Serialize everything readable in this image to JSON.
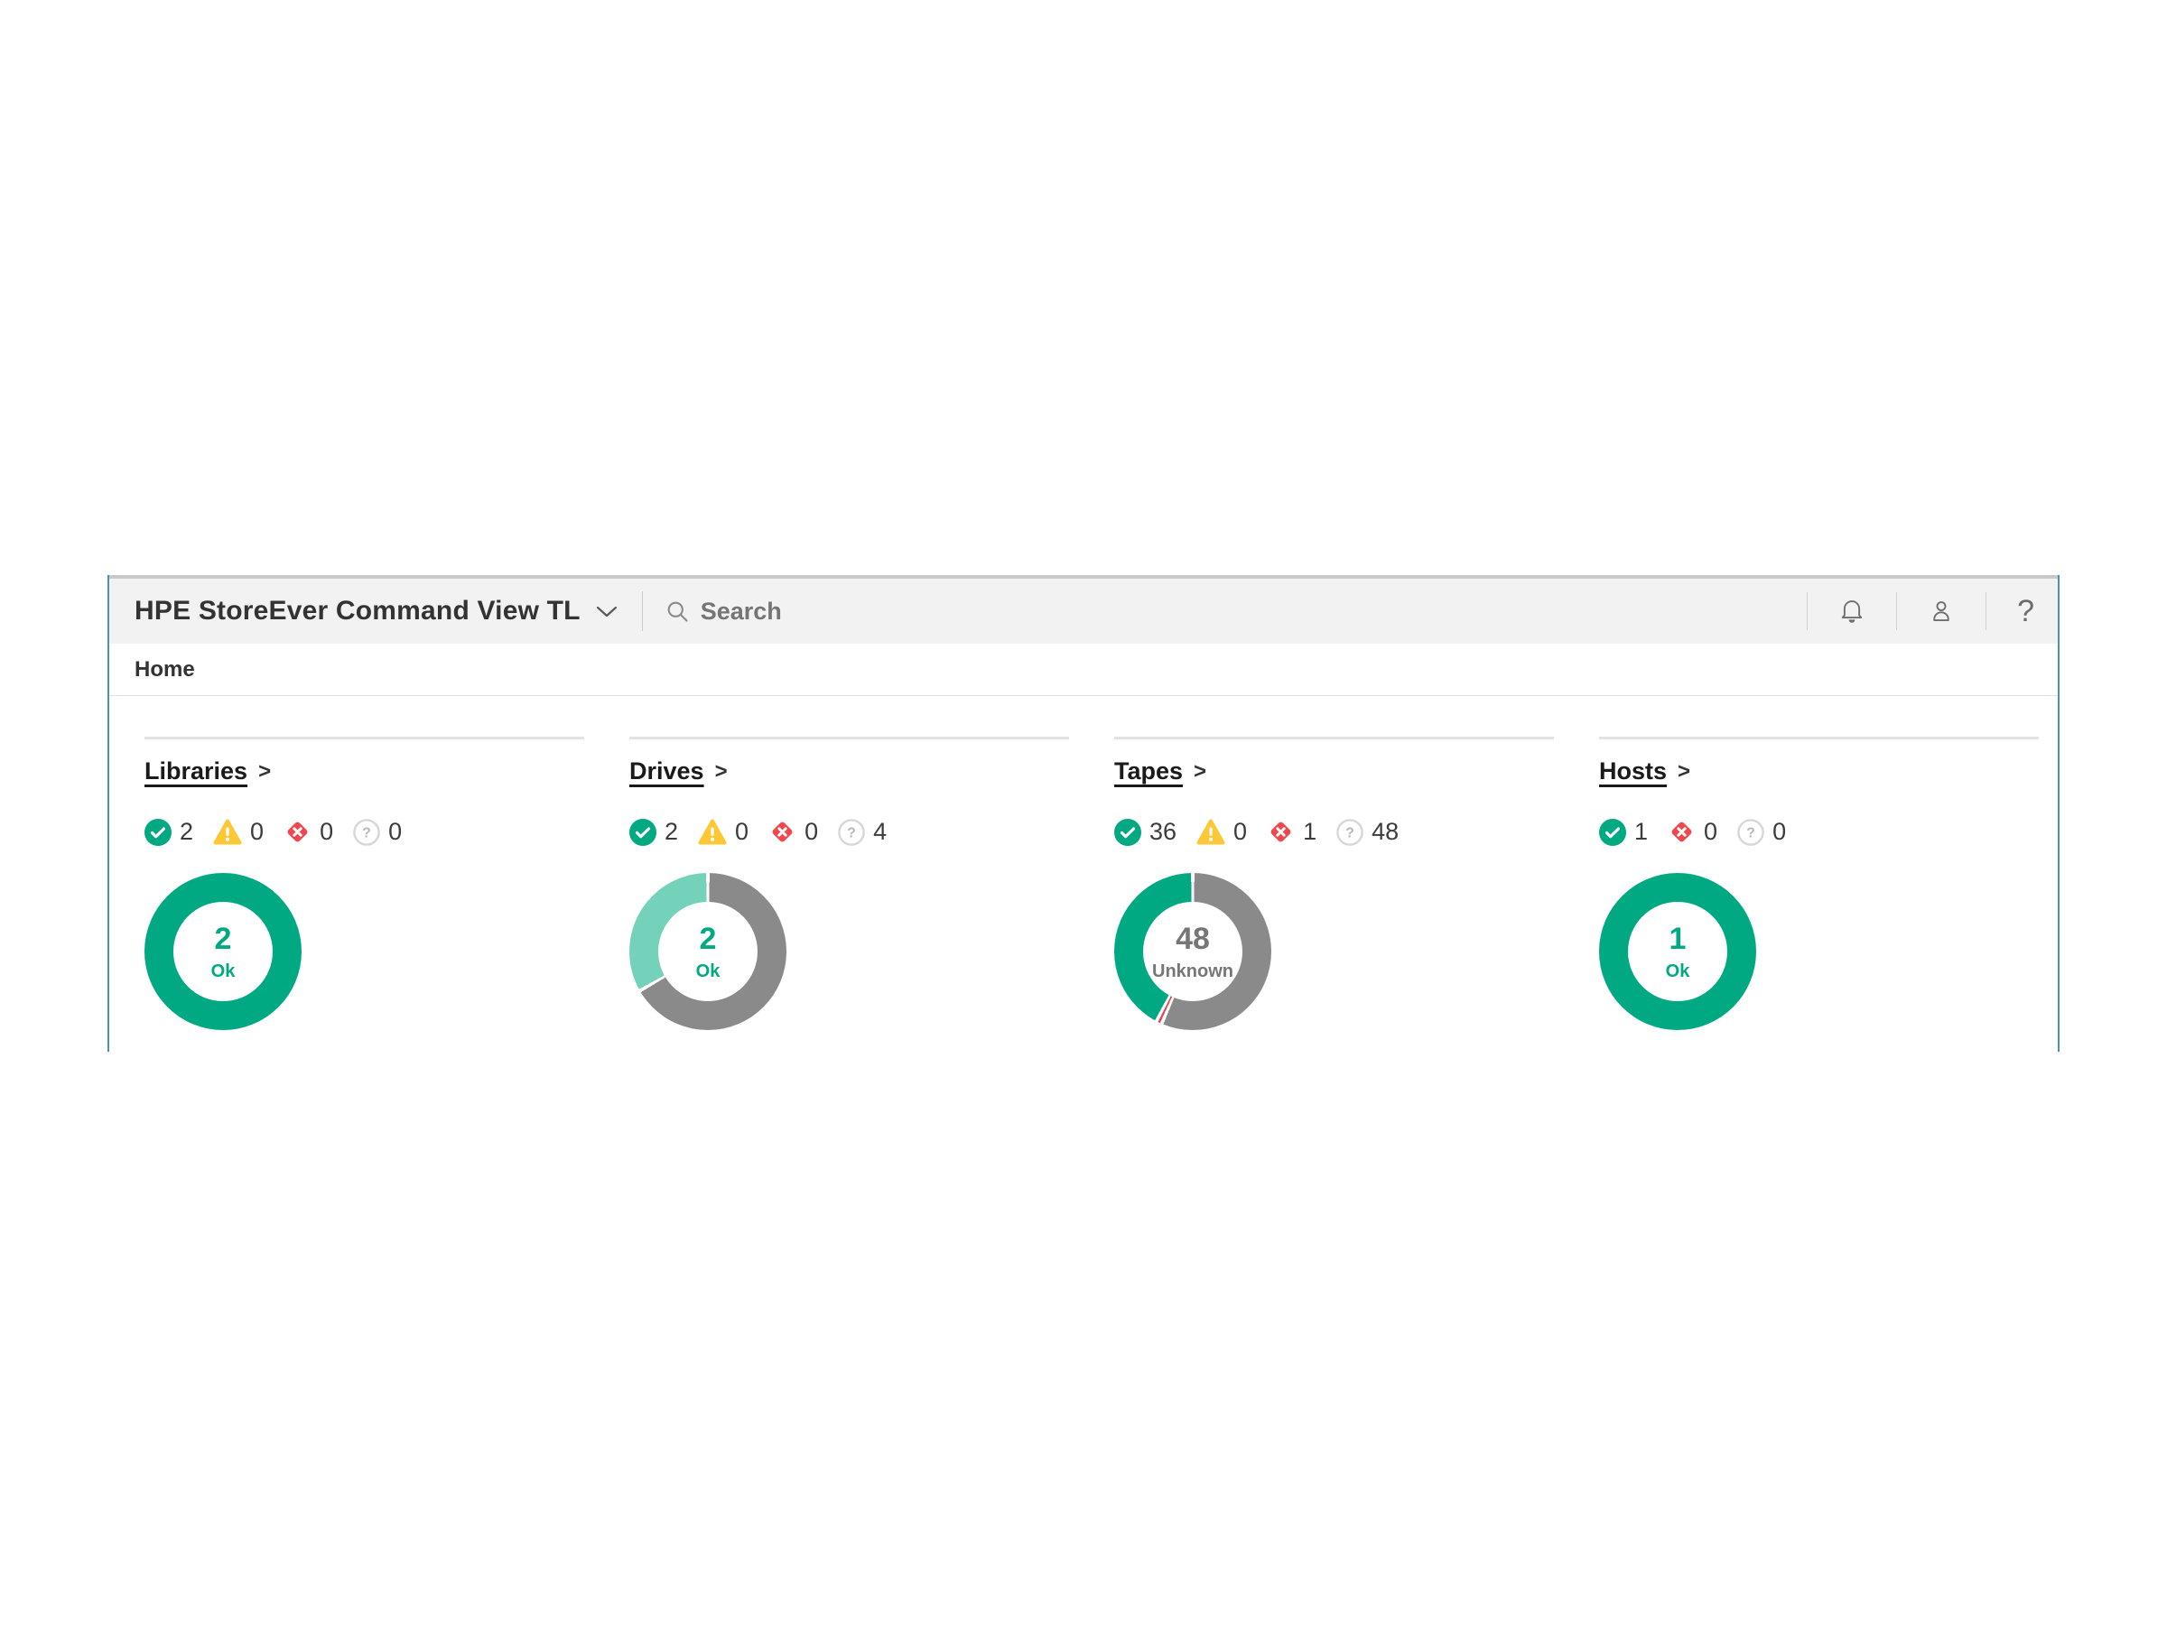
{
  "app": {
    "title": "HPE StoreEver Command View TL",
    "search_placeholder": "Search",
    "help_label": "?"
  },
  "breadcrumb": {
    "home": "Home"
  },
  "ui": {
    "link_chevron": ">"
  },
  "colors": {
    "green": "#00a982",
    "teal_light": "#74d2bb",
    "gray_segment": "#8a8a8a",
    "red": "#f0474d",
    "yellow": "#fdc836",
    "band_border_blue": "#4695b5"
  },
  "panels": [
    {
      "title": "Libraries",
      "statuses": [
        {
          "type": "ok",
          "count": "2"
        },
        {
          "type": "warning",
          "count": "0"
        },
        {
          "type": "error",
          "count": "0"
        },
        {
          "type": "unknown",
          "count": "0"
        }
      ],
      "donut": {
        "value": "2",
        "label": "Ok",
        "text_color": "#00a982",
        "segments": [
          {
            "name": "ok",
            "value": 2,
            "color": "#00a982"
          }
        ]
      }
    },
    {
      "title": "Drives",
      "statuses": [
        {
          "type": "ok",
          "count": "2"
        },
        {
          "type": "warning",
          "count": "0"
        },
        {
          "type": "error",
          "count": "0"
        },
        {
          "type": "unknown",
          "count": "4"
        }
      ],
      "donut": {
        "value": "2",
        "label": "Ok",
        "text_color": "#00a982",
        "segments": [
          {
            "name": "unknown",
            "value": 4,
            "color": "#8a8a8a"
          },
          {
            "name": "ok",
            "value": 2,
            "color": "#74d2bb"
          }
        ]
      }
    },
    {
      "title": "Tapes",
      "statuses": [
        {
          "type": "ok",
          "count": "36"
        },
        {
          "type": "warning",
          "count": "0"
        },
        {
          "type": "error",
          "count": "1"
        },
        {
          "type": "unknown",
          "count": "48"
        }
      ],
      "donut": {
        "value": "48",
        "label": "Unknown",
        "text_color": "#767676",
        "segments": [
          {
            "name": "unknown",
            "value": 48,
            "color": "#8a8a8a"
          },
          {
            "name": "error",
            "value": 1,
            "color": "#e8444b"
          },
          {
            "name": "ok",
            "value": 36,
            "color": "#00a982"
          }
        ]
      }
    },
    {
      "title": "Hosts",
      "statuses": [
        {
          "type": "ok",
          "count": "1"
        },
        {
          "type": "error",
          "count": "0"
        },
        {
          "type": "unknown",
          "count": "0"
        }
      ],
      "donut": {
        "value": "1",
        "label": "Ok",
        "text_color": "#00a982",
        "segments": [
          {
            "name": "ok",
            "value": 1,
            "color": "#00a982"
          }
        ]
      }
    }
  ]
}
